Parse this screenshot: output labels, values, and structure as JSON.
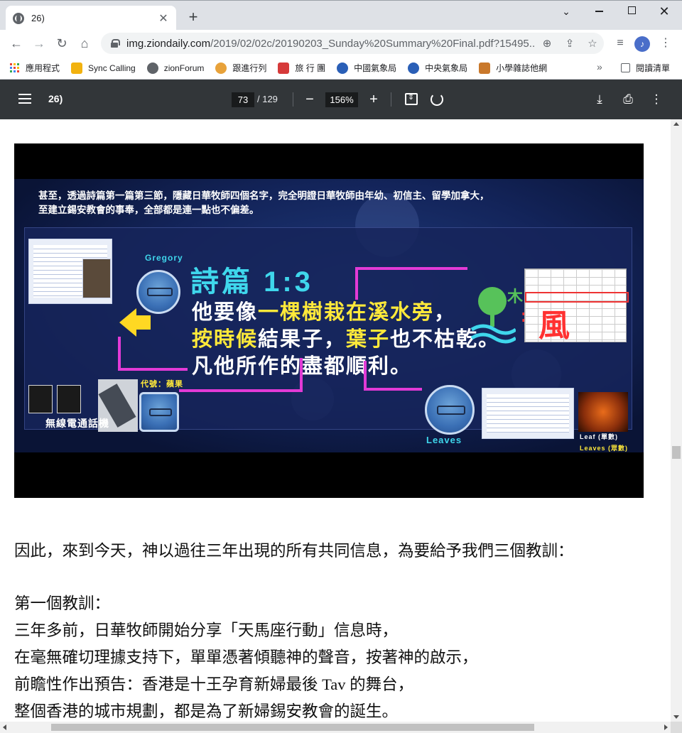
{
  "tab": {
    "title": "26)",
    "close_glyph": "✕"
  },
  "new_tab_glyph": "+",
  "window_controls": {
    "down": "⌄",
    "close": "✕"
  },
  "toolbar": {
    "back": "←",
    "forward": "→",
    "reload": "↻",
    "home": "⌂",
    "url_host": "img.ziondaily.com",
    "url_path": "/2019/02/02c/20190203_Sunday%20Summary%20Final.pdf?15495...",
    "zoom_icon": "⊕",
    "share_icon": "⇪",
    "star_icon": "☆",
    "media_icon": "≡",
    "profile_glyph": "♪",
    "menu_icon": "⋮"
  },
  "bookmarks": [
    {
      "label": "應用程式",
      "icon": "apps-grid"
    },
    {
      "label": "Sync Calling",
      "color": "#f2b20f"
    },
    {
      "label": "zionForum",
      "color": "#5f6368"
    },
    {
      "label": "跟進行列",
      "color": "#e8a23a"
    },
    {
      "label": "旅 行 團",
      "color": "#d63a3a"
    },
    {
      "label": "中國氣象局",
      "color": "#2a5fb7"
    },
    {
      "label": "中央氣象局",
      "color": "#2a5fb7"
    },
    {
      "label": "小學雜誌他網",
      "color": "#c9782b"
    }
  ],
  "bookmarks_more": "»",
  "reading_list": "閱讀清單",
  "pdf": {
    "title": "26)",
    "page_current": "73",
    "page_total": "/ 129",
    "zoom_minus": "−",
    "zoom_value": "156%",
    "zoom_plus": "+",
    "download_icon": "⤓",
    "print_icon": "⎙",
    "more_icon": "⋮"
  },
  "slide": {
    "caption_1": "甚至，透過詩篇第一篇第三節，隱藏日華牧師四個名字，完全明證日華牧師由年幼、初信主、留學加拿大，",
    "caption_2": "至建立錫安教會的事奉，全部都是連一點也不偏差。",
    "verse_ref": "詩篇 1:3",
    "line1_a": "他要像",
    "line1_b": "一棵樹栽在溪水旁",
    "line1_c": "，",
    "line2_a": "按時候",
    "line2_b": "結果子，",
    "line2_c": "葉子",
    "line2_d": "也不枯乾。",
    "line3": "凡他所作的盡都順利。",
    "gregory": "Gregory",
    "leaves": "Leaves",
    "walkie_label": "無線電通話機",
    "wood": "木",
    "equals": "=",
    "feng": "風",
    "code_apple": "代號：蘋果",
    "leaf_label": "Leaf (單數)",
    "leaves_label": "Leaves (眾數)"
  },
  "body": {
    "p1": "因此，來到今天，神以過往三年出現的所有共同信息，為要給予我們三個教訓：",
    "h1": "第一個教訓：",
    "l1": "三年多前，日華牧師開始分享「天馬座行動」信息時，",
    "l2": "在毫無確切理據支持下，單單憑著傾聽神的聲音，按著神的啟示，",
    "l3": "前瞻性作出預告：香港是十王孕育新婦最後 Tav 的舞台，",
    "l4": "整個香港的城市規劃，都是為了新婦錫安教會的誕生。"
  }
}
